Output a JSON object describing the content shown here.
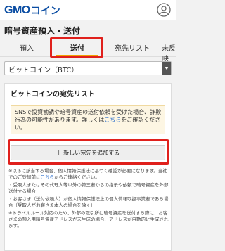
{
  "header": {
    "logo_gmo": "GMO",
    "logo_coin": "コイン",
    "user_icon": "user-circle-icon"
  },
  "page": {
    "title": "暗号資産預入・送付"
  },
  "tabs": [
    {
      "label": "預入",
      "active": false
    },
    {
      "label": "送付",
      "active": true
    },
    {
      "label": "宛先リスト",
      "active": false
    },
    {
      "label": "未反映",
      "active": false
    }
  ],
  "select": {
    "value": "ビットコイン（BTC）"
  },
  "address_list": {
    "title": "ビットコインの宛先リスト",
    "notice_before": "SNSで投資勧誘や暗号資産の送付依頼を受けた場合、詐欺行為の可能性があります。詳しくは",
    "notice_link": "こちら",
    "notice_after": "をご確認ください。",
    "add_button": "＋ 新しい宛先を追加する",
    "fine_1": "※以下に該当する場合、個人情報保護法に基づく確認が必要になります。当社でのご登録前に",
    "fine_1_link": "こちら",
    "fine_1_after": "からご連絡ください。",
    "fine_2": "・受取人またはその代理人等以外の第三者からの指示や依頼で暗号資産を外部送付する場合",
    "fine_3": "・お客さま（送付依頼人）が個人情報保護法上の個人情報取扱事業者である場合（受取人がお客さま本人の場合を除く）",
    "fine_4": "※トラベルルール対応のため、外部の取引所に暗号資産を送付する際に、お客さまの預入用暗号資産アドレスが未生成の場合、アドレスが自動的に生成されます。"
  },
  "colors": {
    "brand": "#0a4da3",
    "accent": "#f0a000",
    "highlight": "#e0201c",
    "link": "#1a63c9"
  }
}
